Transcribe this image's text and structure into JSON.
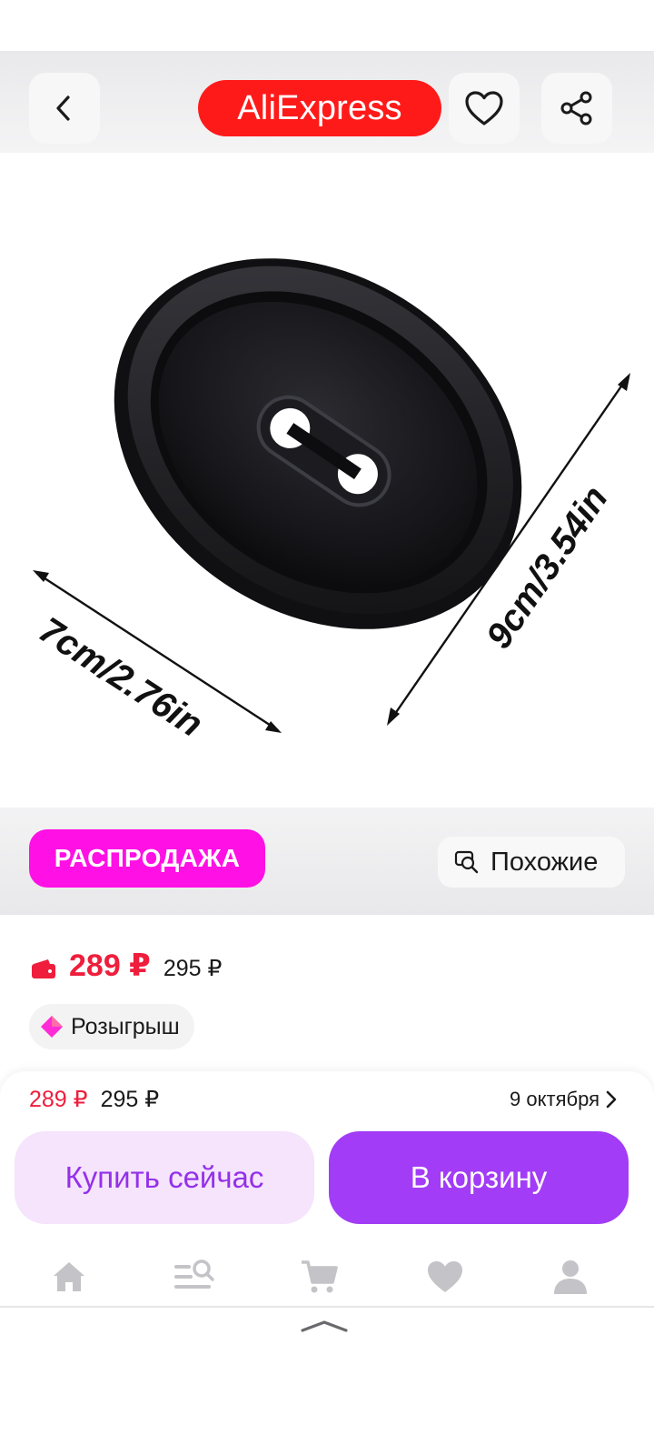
{
  "header": {
    "logo_text": "AliExpress",
    "logo_color": "#ff1a1a",
    "back_icon": "chevron-left-icon",
    "favorite_icon": "heart-outline-icon",
    "share_icon": "share-icon"
  },
  "product_image": {
    "dimension_width": "7cm/2.76in",
    "dimension_height": "9cm/3.54in"
  },
  "sale_strip": {
    "badge": "РАСПРОДАЖА",
    "badge_color": "#ff10e4",
    "similar_label": "Похожие",
    "similar_icon": "search-similar-icon"
  },
  "price_card": {
    "price": "289 ₽",
    "old_price": "295 ₽",
    "price_color": "#ee1e3c",
    "wallet_icon": "wallet-icon",
    "raffle_label": "Розыгрыш",
    "raffle_icon": "diamond-icon"
  },
  "purchase_panel": {
    "price": "289 ₽",
    "old_price": "295 ₽",
    "delivery_date": "9 октября",
    "buy_now_label": "Купить сейчас",
    "add_to_cart_label": "В корзину",
    "accent_color": "#a23cf6"
  },
  "bottom_nav": {
    "items": [
      {
        "icon": "home-icon"
      },
      {
        "icon": "catalog-search-icon"
      },
      {
        "icon": "cart-icon"
      },
      {
        "icon": "favorites-icon"
      },
      {
        "icon": "profile-icon"
      }
    ]
  }
}
